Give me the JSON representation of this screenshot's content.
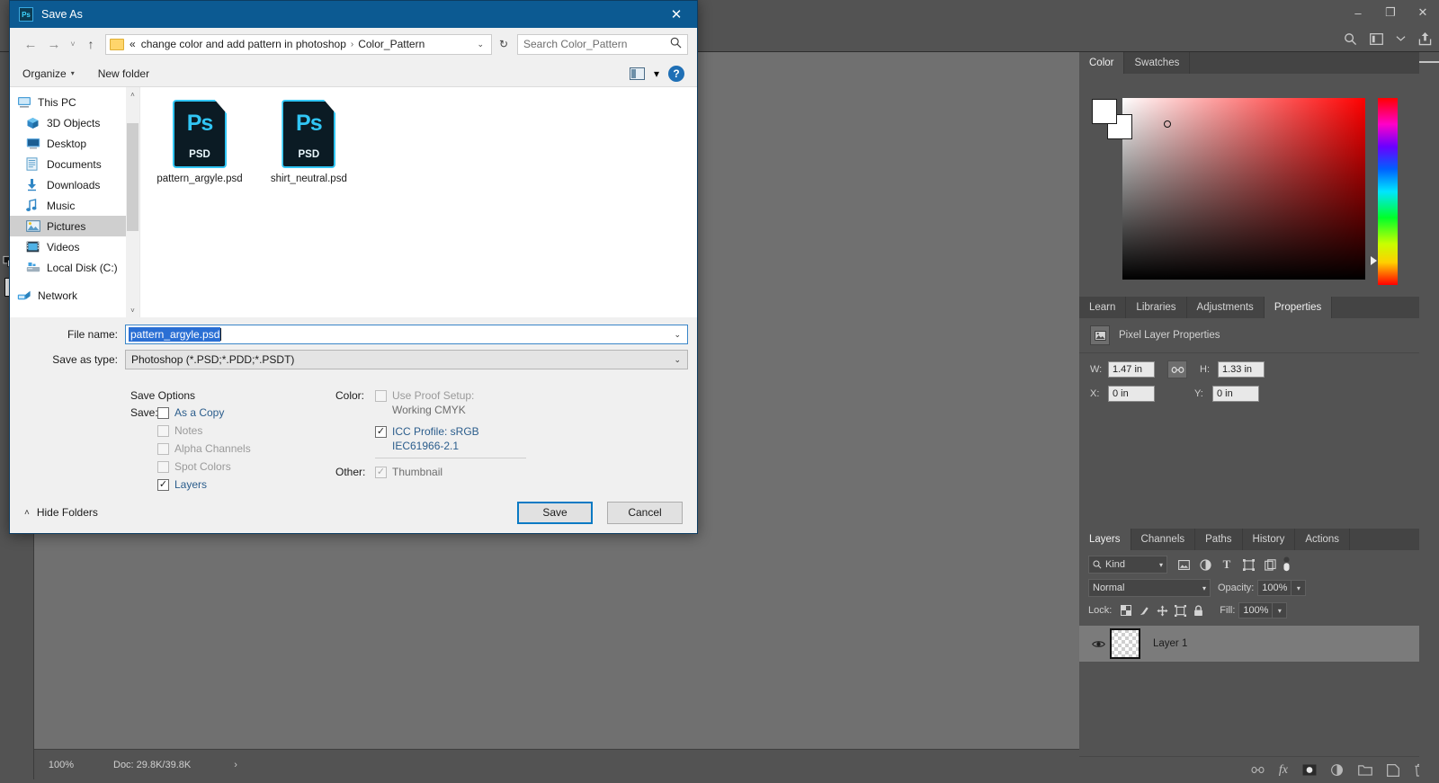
{
  "app": {
    "name": "Adobe Photoshop",
    "window_controls": {
      "minimize": "–",
      "restore": "❐",
      "close": "✕"
    }
  },
  "status_bar": {
    "zoom": "100%",
    "doc_info": "Doc: 29.8K/39.8K",
    "expand_arrow": "›"
  },
  "toolbar": {
    "tools": [
      {
        "name": "zoom-tool",
        "glyph": "search-icon"
      },
      {
        "name": "more-tools",
        "glyph": "ellipsis-icon"
      },
      {
        "name": "quick-mask-swap",
        "glyph": "swap-icon"
      },
      {
        "name": "foreground-background-color",
        "glyph": "color-swatches"
      },
      {
        "name": "edit-in-quick-mask",
        "glyph": "quickmask-icon"
      },
      {
        "name": "screen-mode",
        "glyph": "screenmode-icon"
      }
    ]
  },
  "options_bar": {
    "icons": [
      "search-icon",
      "workspace-icon",
      "chevron-down-icon",
      "share-icon"
    ]
  },
  "color_panel": {
    "tabs": [
      {
        "label": "Color",
        "active": true
      },
      {
        "label": "Swatches",
        "active": false
      }
    ],
    "foreground_color": "#ffffff",
    "background_color": "#ffffff",
    "field_base_hue": "#ff0000"
  },
  "properties_panel": {
    "tabs": [
      {
        "label": "Learn",
        "active": false
      },
      {
        "label": "Libraries",
        "active": false
      },
      {
        "label": "Adjustments",
        "active": false
      },
      {
        "label": "Properties",
        "active": true
      }
    ],
    "header_title": "Pixel Layer Properties",
    "fields": {
      "w_label": "W:",
      "w_value": "1.47 in",
      "h_label": "H:",
      "h_value": "1.33 in",
      "x_label": "X:",
      "x_value": "0 in",
      "y_label": "Y:",
      "y_value": "0 in",
      "link_icon": "link-icon"
    }
  },
  "layers_panel": {
    "tabs": [
      {
        "label": "Layers",
        "active": true
      },
      {
        "label": "Channels",
        "active": false
      },
      {
        "label": "Paths",
        "active": false
      },
      {
        "label": "History",
        "active": false
      },
      {
        "label": "Actions",
        "active": false
      }
    ],
    "filter_kind": "Kind",
    "filter_icons": [
      "pixel-layer-filter-icon",
      "adjustment-layer-filter-icon",
      "type-layer-filter-icon",
      "shape-layer-filter-icon",
      "smart-object-filter-icon"
    ],
    "blend_mode": "Normal",
    "opacity_label": "Opacity:",
    "opacity_value": "100%",
    "lock_label": "Lock:",
    "lock_icons": [
      "lock-transparent-pixels-icon",
      "lock-image-pixels-icon",
      "lock-position-icon",
      "lock-artboard-nesting-icon",
      "lock-all-icon"
    ],
    "fill_label": "Fill:",
    "fill_value": "100%",
    "layers": [
      {
        "name": "Layer 1",
        "visible": true,
        "selected": true
      }
    ],
    "footer_icons": [
      "link-layers-icon",
      "layer-style-fx-icon",
      "layer-mask-icon",
      "adjustment-layer-icon",
      "new-group-icon",
      "new-layer-icon",
      "delete-layer-icon"
    ]
  },
  "save_as_dialog": {
    "title": "Save As",
    "app_icon": "Ps",
    "close_icon": "✕",
    "nav": {
      "back_icon": "←",
      "forward_icon": "→",
      "recent_icon": "˅",
      "up_icon": "↑",
      "refresh_icon": "↻",
      "breadcrumb_prefix": "«",
      "breadcrumb_parts": [
        "change color and add pattern in photoshop",
        "Color_Pattern"
      ],
      "breadcrumb_separator": "›",
      "breadcrumb_caret": "⌄",
      "search_placeholder": "Search Color_Pattern",
      "search_icon": "search-icon"
    },
    "command_bar": {
      "organize": "Organize",
      "organize_caret": "▾",
      "new_folder": "New folder",
      "view_icon": "view-layout-icon",
      "view_caret": "▾",
      "help_icon": "?"
    },
    "tree": {
      "items": [
        {
          "label": "This PC",
          "icon": "this-pc-icon",
          "level": 0,
          "selected": false
        },
        {
          "label": "3D Objects",
          "icon": "3d-objects-icon",
          "level": 1,
          "selected": false
        },
        {
          "label": "Desktop",
          "icon": "desktop-icon",
          "level": 1,
          "selected": false
        },
        {
          "label": "Documents",
          "icon": "documents-icon",
          "level": 1,
          "selected": false
        },
        {
          "label": "Downloads",
          "icon": "downloads-icon",
          "level": 1,
          "selected": false
        },
        {
          "label": "Music",
          "icon": "music-icon",
          "level": 1,
          "selected": false
        },
        {
          "label": "Pictures",
          "icon": "pictures-icon",
          "level": 1,
          "selected": true
        },
        {
          "label": "Videos",
          "icon": "videos-icon",
          "level": 1,
          "selected": false
        },
        {
          "label": "Local Disk (C:)",
          "icon": "local-disk-icon",
          "level": 1,
          "selected": false
        },
        {
          "label": "Network",
          "icon": "network-icon",
          "level": 0,
          "selected": false
        }
      ],
      "scroll_up": "˄",
      "scroll_down": "˅"
    },
    "files": [
      {
        "name": "pattern_argyle.psd",
        "type_label": "PSD",
        "badge": "Ps",
        "selected": true
      },
      {
        "name": "shirt_neutral.psd",
        "type_label": "PSD",
        "badge": "Ps",
        "selected": false
      }
    ],
    "fields": {
      "file_name_label": "File name:",
      "file_name_value": "pattern_argyle.psd",
      "save_as_type_label": "Save as type:",
      "save_as_type_value": "Photoshop (*.PSD;*.PDD;*.PSDT)",
      "caret": "⌄"
    },
    "save_options": {
      "title": "Save Options",
      "save_label": "Save:",
      "color_label": "Color:",
      "other_label": "Other:",
      "left_items": [
        {
          "label": "As a Copy",
          "checked": false,
          "enabled": true
        },
        {
          "label": "Notes",
          "checked": false,
          "enabled": false
        },
        {
          "label": "Alpha Channels",
          "checked": false,
          "enabled": false
        },
        {
          "label": "Spot Colors",
          "checked": false,
          "enabled": false
        },
        {
          "label": "Layers",
          "checked": true,
          "enabled": true
        }
      ],
      "color_items": [
        {
          "label": "Use Proof Setup:",
          "sublabel": "Working CMYK",
          "checked": false,
          "enabled": false
        },
        {
          "label": "ICC Profile:  sRGB",
          "sublabel": "IEC61966-2.1",
          "checked": true,
          "enabled": true
        }
      ],
      "other_items": [
        {
          "label": "Thumbnail",
          "checked": true,
          "enabled": false
        }
      ],
      "check_glyph": "✓"
    },
    "footer": {
      "hide_folders": "Hide Folders",
      "hide_folders_caret": "˄",
      "save_button": "Save",
      "cancel_button": "Cancel"
    }
  }
}
